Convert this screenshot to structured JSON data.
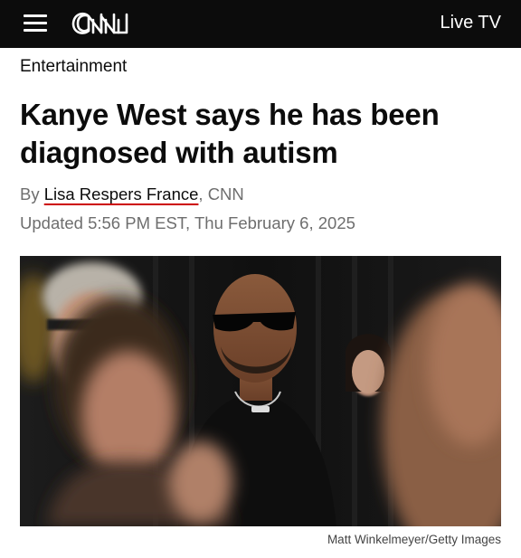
{
  "header": {
    "logo_text": "CNN",
    "live_tv_label": "Live TV",
    "menu_icon": "hamburger-menu-icon"
  },
  "article": {
    "section": "Entertainment",
    "headline_line1": "Kanye West says he has been",
    "headline_line2": "diagnosed with autism",
    "byline_prefix": "By ",
    "author": "Lisa Respers France",
    "byline_suffix": ", CNN",
    "updated": "Updated 5:56 PM EST, Thu February 6, 2025",
    "photo_credit": "Matt Winkelmeyer/Getty Images"
  },
  "colors": {
    "header_bg": "#0c0c0c",
    "text": "#0c0c0c",
    "muted_text": "#6e6e6e",
    "accent": "#cc0000"
  }
}
